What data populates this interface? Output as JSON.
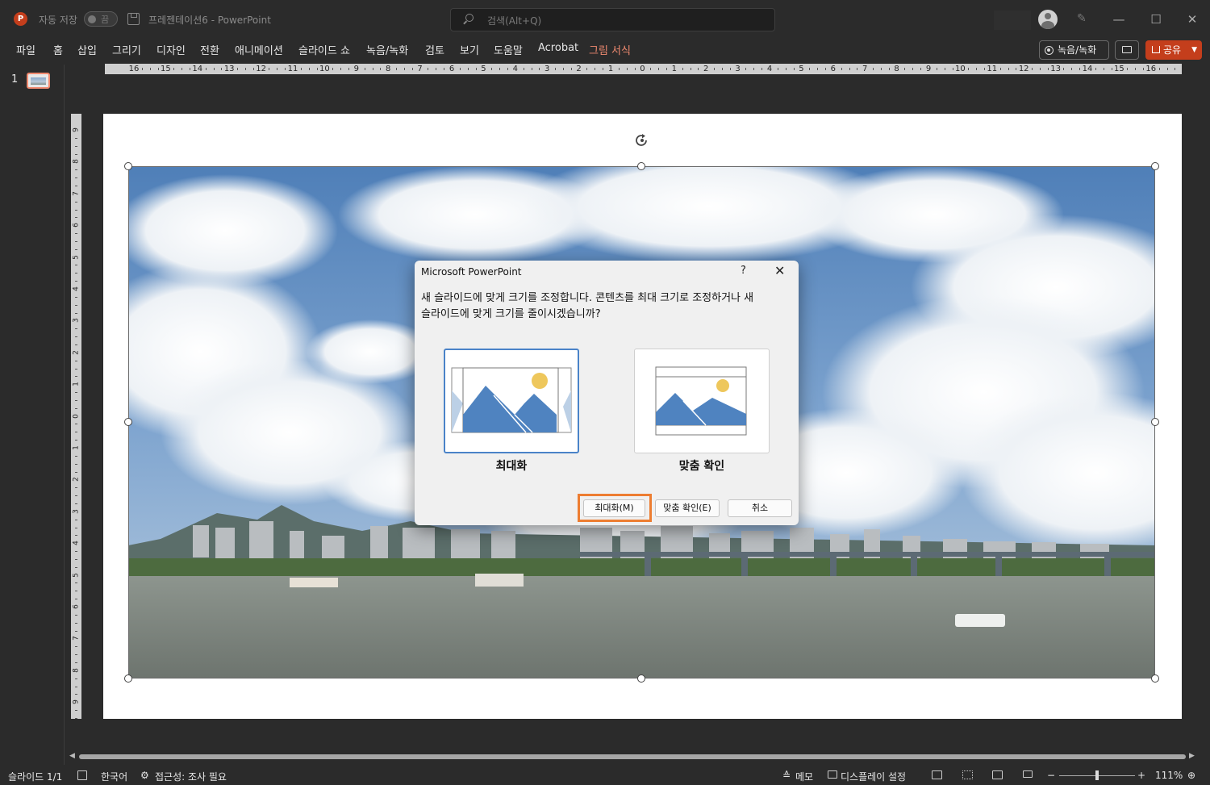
{
  "titlebar": {
    "autosave_label": "자동 저장",
    "autosave_toggle": "끔",
    "doc_title": "프레젠테이션6  -  PowerPoint",
    "search_placeholder": "검색(Alt+Q)",
    "minimize": "—",
    "maximize": "☐",
    "close": "✕"
  },
  "menu": {
    "items": [
      "파일",
      "홈",
      "삽입",
      "그리기",
      "디자인",
      "전환",
      "애니메이션",
      "슬라이드 쇼",
      "녹음/녹화",
      "검토",
      "보기",
      "도움말",
      "Acrobat",
      "그림 서식"
    ],
    "active_index": 13,
    "record_button": "녹음/녹화",
    "share_button": "공유"
  },
  "thumbnails": {
    "slide_number": "1"
  },
  "ruler": {
    "horizontal": [
      "16",
      "15",
      "14",
      "13",
      "12",
      "11",
      "10",
      "9",
      "8",
      "7",
      "6",
      "5",
      "4",
      "3",
      "2",
      "1",
      "0",
      "1",
      "2",
      "3",
      "4",
      "5",
      "6",
      "7",
      "8",
      "9",
      "10",
      "11",
      "12",
      "13",
      "14",
      "15",
      "16"
    ],
    "vertical": [
      "9",
      "8",
      "7",
      "6",
      "5",
      "4",
      "3",
      "2",
      "1",
      "0",
      "1",
      "2",
      "3",
      "4",
      "5",
      "6",
      "7",
      "8",
      "9"
    ]
  },
  "dialog": {
    "title": "Microsoft PowerPoint",
    "help": "?",
    "close": "✕",
    "message": "새 슬라이드에 맞게 크기를 조정합니다. 콘텐츠를 최대 크기로 조정하거나 새 슬라이드에 맞게 크기를 줄이시겠습니까?",
    "option_maximize": "최대화",
    "option_fit": "맞춤 확인",
    "btn_maximize": "최대화(M)",
    "btn_fit": "맞춤 확인(E)",
    "btn_cancel": "취소"
  },
  "statusbar": {
    "slide_info": "슬라이드 1/1",
    "language": "한국어",
    "accessibility": "접근성: 조사 필요",
    "notes": "메모",
    "display_settings": "디스플레이 설정",
    "zoom_minus": "−",
    "zoom_plus": "+",
    "zoom_level": "111%"
  },
  "colors": {
    "accent": "#c43e1c",
    "active_tab": "#f08a70",
    "highlight": "#ed7d31",
    "selection": "#4a83c8"
  }
}
